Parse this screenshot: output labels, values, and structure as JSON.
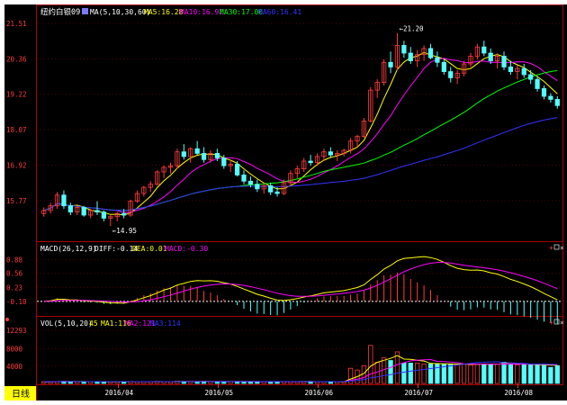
{
  "header": {
    "symbol": "纽约白银09",
    "ma_label": "MA(5,10,30,60)",
    "ma5": "MA5:16.28",
    "ma10": "MA10:16.92",
    "ma30": "MA30:17.06",
    "ma60": "MA60:16.41"
  },
  "macd_header": {
    "label": "MACD(26,12,9)",
    "diff": "DIFF:-0.14",
    "dea": "DEA:0.01",
    "macd": "MACD:-0.30"
  },
  "vol_header": {
    "label": "VOL(5,10,20)",
    "vol": "45",
    "ma1": "MA1:116",
    "ma2": "MA2:121",
    "ma3": "MA3:114"
  },
  "period_label": "日线",
  "colors": {
    "background": "#000000",
    "up": "#ff3c3c",
    "down": "#54ffff",
    "ma5": "#ffffff",
    "ma10": "#ffff00",
    "ma30": "#ff00ff",
    "ma60": "#00ff00",
    "ma_long": "#3333ff",
    "frame": "#aa0000",
    "axis_text": "#ff3c3c",
    "period_bg": "#ffff00"
  },
  "chart_data": [
    {
      "type": "candlestick",
      "yticks": [
        "21.51",
        "20.36",
        "19.22",
        "18.07",
        "16.92",
        "15.77"
      ],
      "ylim": [
        14.6,
        21.6
      ],
      "xticks": [
        "2016/04",
        "2016/05",
        "2016/06",
        "2016/07",
        "2016/08"
      ],
      "annotations": [
        {
          "label": "←14.95",
          "value": 14.95,
          "bar": 10
        },
        {
          "label": "←21.20",
          "value": 21.2,
          "bar": 53
        }
      ],
      "ohlc": [
        [
          15.35,
          15.55,
          15.25,
          15.45
        ],
        [
          15.45,
          15.7,
          15.35,
          15.6
        ],
        [
          15.6,
          16.05,
          15.5,
          15.95
        ],
        [
          15.95,
          16.1,
          15.5,
          15.6
        ],
        [
          15.6,
          15.7,
          15.3,
          15.4
        ],
        [
          15.4,
          15.6,
          15.3,
          15.55
        ],
        [
          15.55,
          15.6,
          15.25,
          15.3
        ],
        [
          15.3,
          15.5,
          15.2,
          15.45
        ],
        [
          15.45,
          15.75,
          15.3,
          15.4
        ],
        [
          15.4,
          15.45,
          15.1,
          15.2
        ],
        [
          15.2,
          15.3,
          14.95,
          15.25
        ],
        [
          15.25,
          15.4,
          15.1,
          15.35
        ],
        [
          15.35,
          15.5,
          15.2,
          15.3
        ],
        [
          15.3,
          15.8,
          15.25,
          15.75
        ],
        [
          15.75,
          16.1,
          15.7,
          16.0
        ],
        [
          16.0,
          16.25,
          15.9,
          16.2
        ],
        [
          16.2,
          16.4,
          16.05,
          16.3
        ],
        [
          16.3,
          16.75,
          16.25,
          16.7
        ],
        [
          16.7,
          16.9,
          16.5,
          16.85
        ],
        [
          16.85,
          17.0,
          16.65,
          16.9
        ],
        [
          16.9,
          17.45,
          16.8,
          17.35
        ],
        [
          17.35,
          17.6,
          17.1,
          17.2
        ],
        [
          17.2,
          17.5,
          17.0,
          17.45
        ],
        [
          17.45,
          17.7,
          17.25,
          17.3
        ],
        [
          17.3,
          17.5,
          17.0,
          17.1
        ],
        [
          17.1,
          17.4,
          17.0,
          17.3
        ],
        [
          17.3,
          17.45,
          17.05,
          17.15
        ],
        [
          17.15,
          17.25,
          16.8,
          16.9
        ],
        [
          16.9,
          17.1,
          16.7,
          16.95
        ],
        [
          16.95,
          17.05,
          16.55,
          16.6
        ],
        [
          16.6,
          16.75,
          16.3,
          16.4
        ],
        [
          16.4,
          16.55,
          16.2,
          16.3
        ],
        [
          16.3,
          16.45,
          16.05,
          16.15
        ],
        [
          16.15,
          16.35,
          16.0,
          16.25
        ],
        [
          16.25,
          16.35,
          15.95,
          16.05
        ],
        [
          16.05,
          16.2,
          15.9,
          16.0
        ],
        [
          16.0,
          16.45,
          15.95,
          16.35
        ],
        [
          16.35,
          16.75,
          16.25,
          16.65
        ],
        [
          16.65,
          16.9,
          16.5,
          16.8
        ],
        [
          16.8,
          17.15,
          16.7,
          17.05
        ],
        [
          17.05,
          17.25,
          16.9,
          17.0
        ],
        [
          17.0,
          17.3,
          16.9,
          17.2
        ],
        [
          17.2,
          17.45,
          17.05,
          17.35
        ],
        [
          17.35,
          17.5,
          17.15,
          17.25
        ],
        [
          17.25,
          17.4,
          17.05,
          17.3
        ],
        [
          17.3,
          17.45,
          17.2,
          17.4
        ],
        [
          17.4,
          17.8,
          17.3,
          17.7
        ],
        [
          17.7,
          17.9,
          17.5,
          17.85
        ],
        [
          17.85,
          18.45,
          17.8,
          18.35
        ],
        [
          18.35,
          19.45,
          18.3,
          19.35
        ],
        [
          19.35,
          19.7,
          19.1,
          19.6
        ],
        [
          19.6,
          20.35,
          19.5,
          20.25
        ],
        [
          20.25,
          20.6,
          19.9,
          20.1
        ],
        [
          20.1,
          21.2,
          20.0,
          20.8
        ],
        [
          20.8,
          20.95,
          20.4,
          20.55
        ],
        [
          20.55,
          20.75,
          20.2,
          20.3
        ],
        [
          20.3,
          20.65,
          20.1,
          20.5
        ],
        [
          20.5,
          20.8,
          20.3,
          20.7
        ],
        [
          20.7,
          20.85,
          20.35,
          20.4
        ],
        [
          20.4,
          20.6,
          20.1,
          20.25
        ],
        [
          20.25,
          20.35,
          19.85,
          19.95
        ],
        [
          19.95,
          20.1,
          19.6,
          19.75
        ],
        [
          19.75,
          20.0,
          19.55,
          19.9
        ],
        [
          19.9,
          20.3,
          19.8,
          20.2
        ],
        [
          20.2,
          20.55,
          20.1,
          20.45
        ],
        [
          20.45,
          20.85,
          20.35,
          20.75
        ],
        [
          20.75,
          20.95,
          20.45,
          20.55
        ],
        [
          20.55,
          20.7,
          20.2,
          20.3
        ],
        [
          20.3,
          20.55,
          20.05,
          20.45
        ],
        [
          20.45,
          20.6,
          20.0,
          20.1
        ],
        [
          20.1,
          20.3,
          19.85,
          19.95
        ],
        [
          19.95,
          20.15,
          19.7,
          20.05
        ],
        [
          20.05,
          20.2,
          19.75,
          19.85
        ],
        [
          19.85,
          20.0,
          19.55,
          19.7
        ],
        [
          19.7,
          19.8,
          19.3,
          19.4
        ],
        [
          19.4,
          19.5,
          19.05,
          19.15
        ],
        [
          19.15,
          19.25,
          18.95,
          19.05
        ],
        [
          19.05,
          19.15,
          18.75,
          18.85
        ]
      ]
    },
    {
      "type": "macd",
      "yticks": [
        "0.88",
        "0.56",
        "0.23",
        "-0.10"
      ],
      "ylim": [
        -0.4,
        1.0
      ]
    },
    {
      "type": "bar",
      "yticks": [
        "12293",
        "8000",
        "4000"
      ],
      "ylim": [
        0,
        12293
      ]
    }
  ]
}
